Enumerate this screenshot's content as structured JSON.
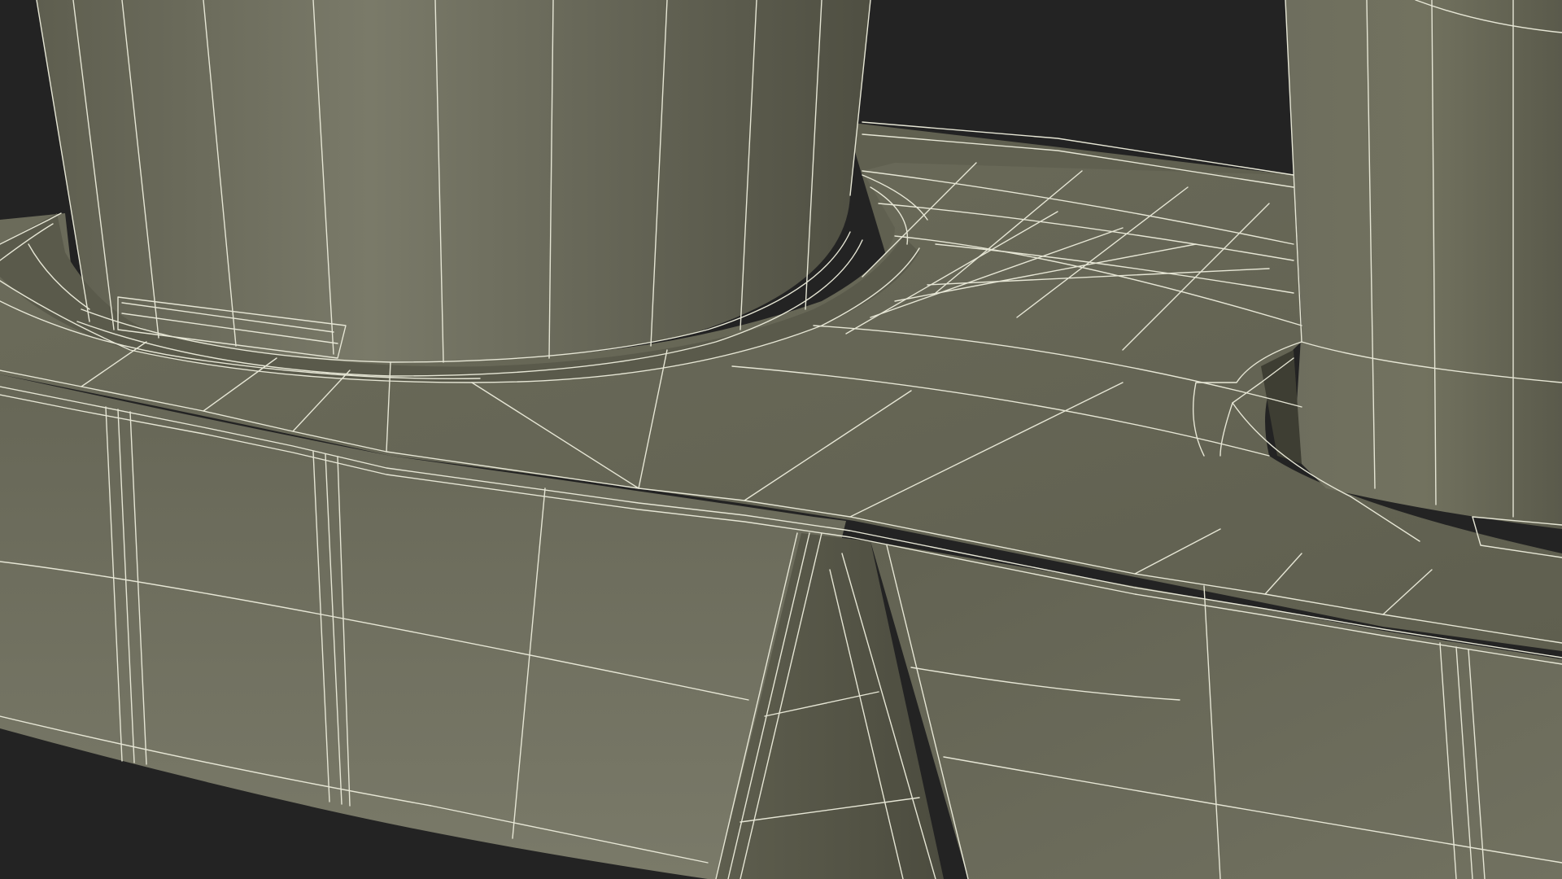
{
  "scene": {
    "subject": "",
    "colors": {
      "background": "#232323",
      "surface_light": "#7a7a6a",
      "surface_mid": "#6b6b5b",
      "surface_dark": "#555546",
      "wireframe": "#e8e8d8"
    }
  }
}
